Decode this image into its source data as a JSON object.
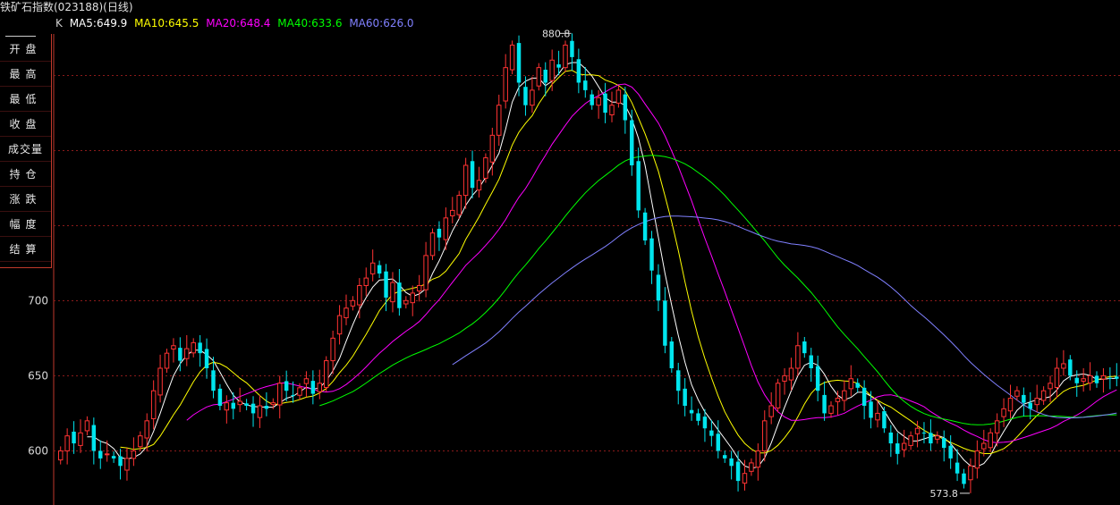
{
  "title": "铁矿石指数(023188)(日线)",
  "legend": {
    "k": "K",
    "ma5": "MA5:649.9",
    "ma10": "MA10:645.5",
    "ma20": "MA20:648.4",
    "ma40": "MA40:633.6",
    "ma60": "MA60:626.0"
  },
  "side_panel": {
    "items": [
      "开盘",
      "最高",
      "最低",
      "收盘",
      "成交量",
      "持仓",
      "涨跌",
      "幅度",
      "结算"
    ]
  },
  "colors": {
    "up": "#ff3333",
    "down": "#00e5ee",
    "ma5": "#ffffff",
    "ma10": "#ffff00",
    "ma20": "#ff00ff",
    "ma40": "#00ff00",
    "ma60": "#8080ff",
    "grid": "#8b1a1a"
  },
  "chart_data": {
    "type": "candlestick",
    "y_ticks": [
      "600",
      "650",
      "700"
    ],
    "ylim": [
      564,
      900
    ],
    "max_label": "880.8",
    "min_label": "573.8",
    "closes": [
      600,
      610,
      605,
      612,
      620,
      600,
      595,
      598,
      595,
      590,
      595,
      600,
      610,
      620,
      640,
      655,
      665,
      670,
      660,
      668,
      672,
      665,
      655,
      640,
      630,
      632,
      628,
      633,
      630,
      625,
      630,
      628,
      632,
      645,
      640,
      637,
      642,
      648,
      638,
      645,
      660,
      675,
      690,
      695,
      700,
      710,
      715,
      725,
      718,
      702,
      712,
      695,
      700,
      705,
      710,
      730,
      745,
      742,
      755,
      760,
      770,
      790,
      775,
      780,
      795,
      810,
      830,
      855,
      870,
      845,
      830,
      840,
      855,
      845,
      860,
      855,
      870,
      862,
      845,
      840,
      830,
      835,
      825,
      830,
      840,
      820,
      790,
      760,
      740,
      720,
      700,
      670,
      655,
      640,
      630,
      625,
      620,
      615,
      610,
      600,
      595,
      590,
      580,
      585,
      592,
      600,
      620,
      630,
      645,
      650,
      655,
      670,
      665,
      655,
      640,
      625,
      630,
      635,
      640,
      648,
      642,
      630,
      622,
      625,
      615,
      605,
      598,
      605,
      610,
      615,
      612,
      605,
      610,
      602,
      595,
      585,
      578,
      590,
      600,
      605,
      612,
      620,
      628,
      635,
      640,
      632,
      628,
      635,
      640,
      645,
      655,
      658,
      650,
      645,
      648,
      650,
      645,
      650,
      648,
      648
    ]
  }
}
